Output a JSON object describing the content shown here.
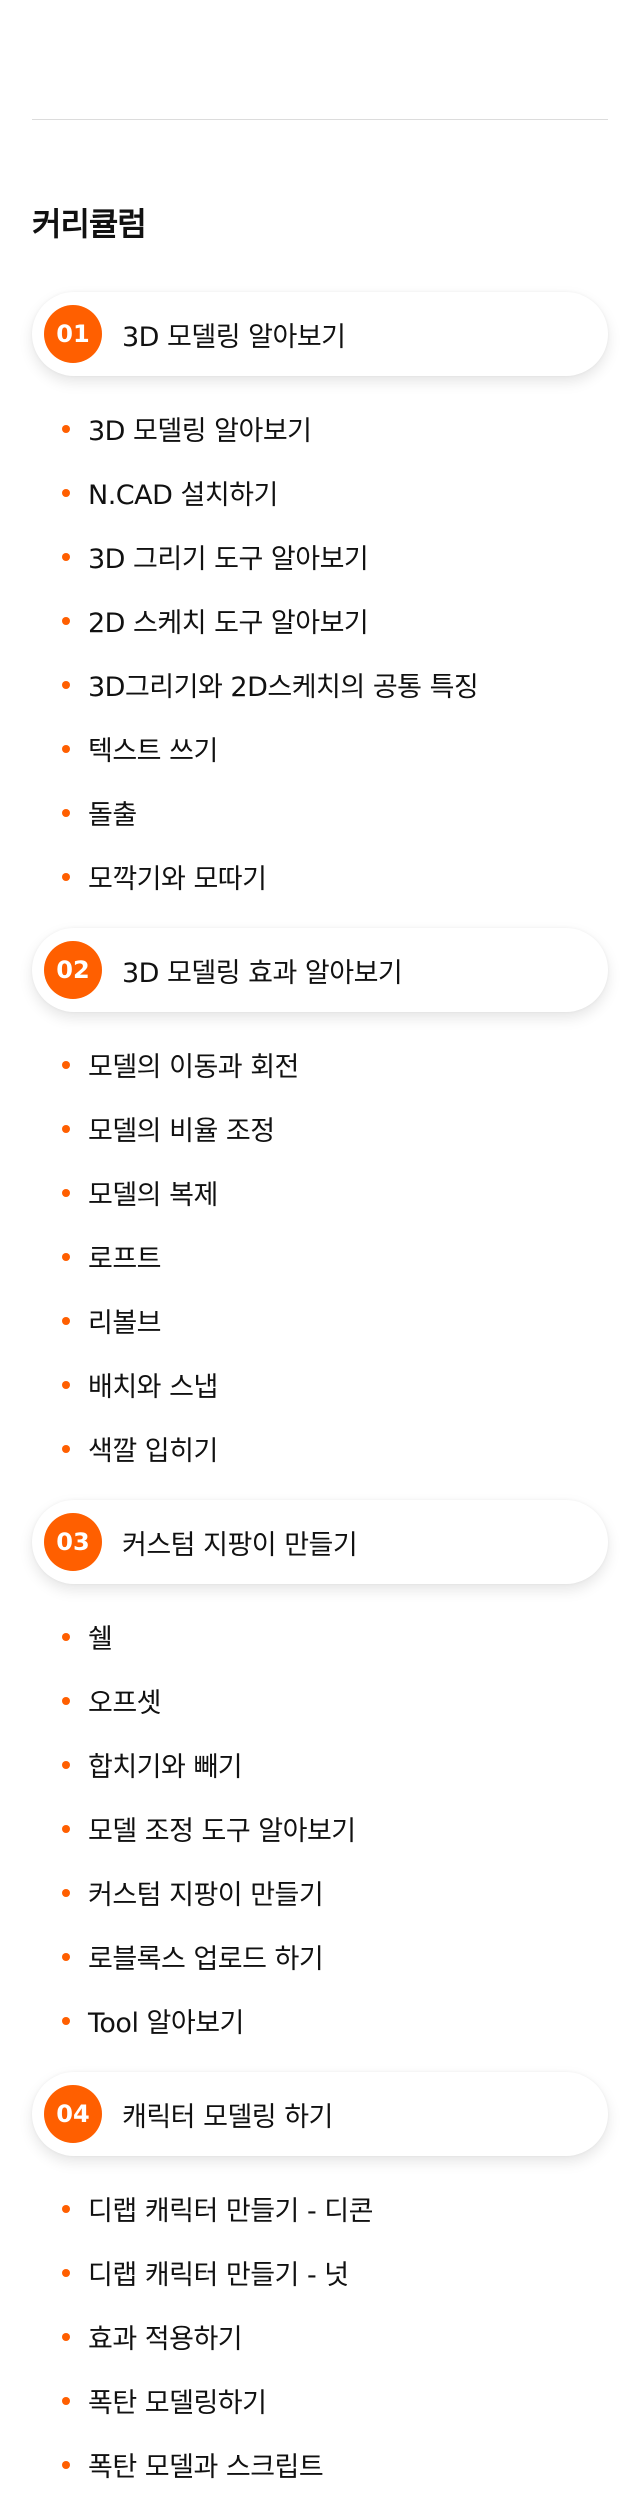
{
  "page": {
    "title": "커리큘럼"
  },
  "colors": {
    "accent": "#ff5f00",
    "text": "#111111",
    "divider": "#dcdcdc"
  },
  "sections": [
    {
      "number": "01",
      "title": "3D 모델링 알아보기",
      "items": [
        "3D 모델링 알아보기",
        "N.CAD 설치하기",
        "3D 그리기 도구 알아보기",
        "2D 스케치 도구 알아보기",
        "3D그리기와 2D스케치의 공통 특징",
        "텍스트 쓰기",
        "돌출",
        "모깍기와 모따기"
      ]
    },
    {
      "number": "02",
      "title": "3D 모델링 효과 알아보기",
      "items": [
        "모델의 이동과 회전",
        "모델의 비율 조정",
        "모델의 복제",
        "로프트",
        "리볼브",
        "배치와 스냅",
        "색깔 입히기"
      ]
    },
    {
      "number": "03",
      "title": "커스텀 지팡이 만들기",
      "items": [
        "쉘",
        "오프셋",
        "합치기와 빼기",
        "모델 조정 도구 알아보기",
        "커스텀 지팡이 만들기",
        "로블록스 업로드 하기",
        "Tool 알아보기"
      ]
    },
    {
      "number": "04",
      "title": "캐릭터 모델링 하기",
      "items": [
        "디랩 캐릭터 만들기 - 디콘",
        "디랩 캐릭터 만들기 - 넛",
        "효과 적용하기",
        "폭탄 모델링하기",
        "폭탄 모델과 스크립트"
      ]
    }
  ]
}
